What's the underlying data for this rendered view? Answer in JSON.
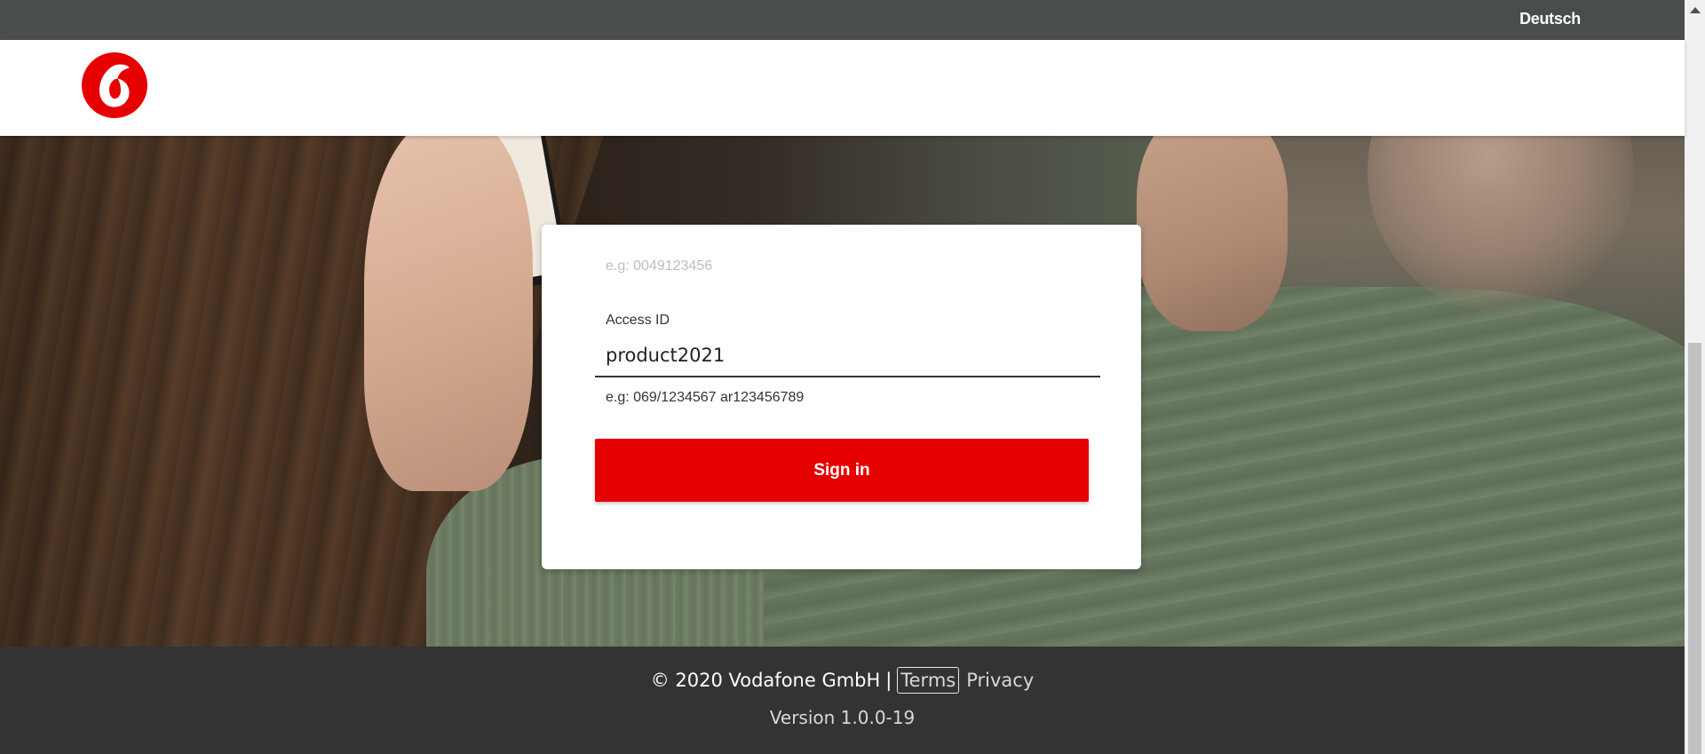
{
  "topbar": {
    "language_label": "Deutsch"
  },
  "header": {
    "logo": "vodafone-logo",
    "brand_color": "#e60000"
  },
  "login": {
    "faded_hint": "e.g: 0049123456",
    "access_id_label": "Access ID",
    "access_id_value": "product2021",
    "access_id_help": "e.g: 069/1234567 ar123456789",
    "signin_label": "Sign in"
  },
  "footer": {
    "copyright": "© 2020 Vodafone GmbH",
    "separator": "|",
    "terms_label": "Terms",
    "privacy_label": "Privacy",
    "version": "Version 1.0.0-19"
  }
}
